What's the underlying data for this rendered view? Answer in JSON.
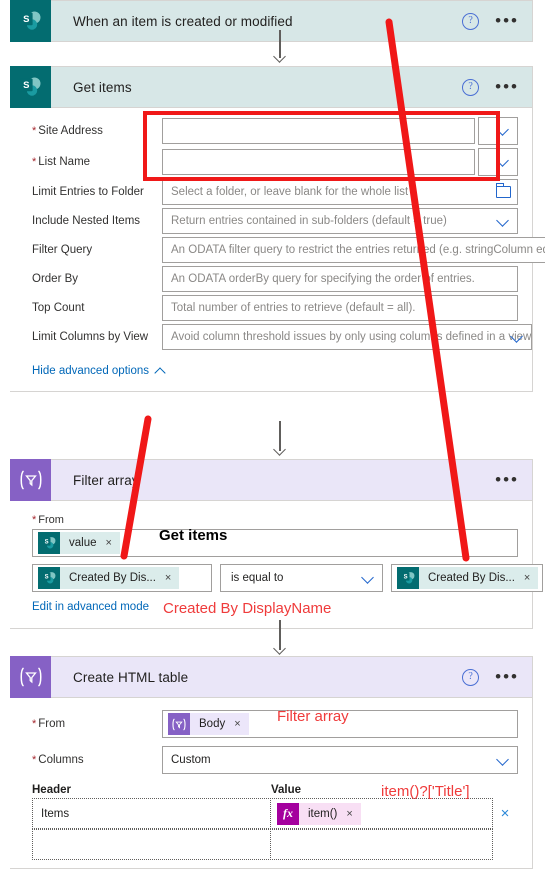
{
  "flow": {
    "steps": [
      {
        "id": "trigger",
        "title": "When an item is created or modified",
        "connector": "sharepoint",
        "icon": "sharepoint-icon",
        "help_icon": "help-icon",
        "more_icon": "more-options-icon"
      },
      {
        "id": "get-items",
        "title": "Get items",
        "connector": "sharepoint",
        "icon": "sharepoint-icon",
        "help_icon": "help-icon",
        "more_icon": "more-options-icon",
        "fields": [
          {
            "label": "Site Address",
            "required": true,
            "value": "",
            "placeholder": "",
            "control": "combo-split"
          },
          {
            "label": "List Name",
            "required": true,
            "value": "",
            "placeholder": "",
            "control": "combo-split"
          },
          {
            "label": "Limit Entries to Folder",
            "required": false,
            "value": "",
            "placeholder": "Select a folder, or leave blank for the whole list",
            "control": "folder-picker"
          },
          {
            "label": "Include Nested Items",
            "required": false,
            "value": "",
            "placeholder": "Return entries contained in sub-folders (default = true)",
            "control": "dropdown"
          },
          {
            "label": "Filter Query",
            "required": false,
            "value": "",
            "placeholder": "An ODATA filter query to restrict the entries returned (e.g. stringColumn eq 'stri",
            "control": "text"
          },
          {
            "label": "Order By",
            "required": false,
            "value": "",
            "placeholder": "An ODATA orderBy query for specifying the order of entries.",
            "control": "text"
          },
          {
            "label": "Top Count",
            "required": false,
            "value": "",
            "placeholder": "Total number of entries to retrieve (default = all).",
            "control": "text"
          },
          {
            "label": "Limit Columns by View",
            "required": false,
            "value": "",
            "placeholder": "Avoid column threshold issues by only using columns defined in a view",
            "control": "dropdown"
          }
        ],
        "advanced_link": "Hide advanced options"
      },
      {
        "id": "filter-array",
        "title": "Filter array",
        "connector": "flow",
        "icon": "filter-array-icon",
        "more_icon": "more-options-icon",
        "from_label": "From",
        "from_token": {
          "text": "value",
          "icon": "sharepoint-icon",
          "remove": "×"
        },
        "condition": {
          "left_token": {
            "text": "Created By Dis...",
            "icon": "sharepoint-icon",
            "remove": "×"
          },
          "operator": "is equal to",
          "right_token": {
            "text": "Created By Dis...",
            "icon": "sharepoint-icon",
            "remove": "×"
          }
        },
        "advanced_mode_link": "Edit in advanced mode"
      },
      {
        "id": "create-html-table",
        "title": "Create HTML table",
        "connector": "flow",
        "icon": "create-html-table-icon",
        "help_icon": "help-icon",
        "more_icon": "more-options-icon",
        "from_label": "From",
        "from_token": {
          "text": "Body",
          "icon": "filter-array-icon",
          "remove": "×"
        },
        "columns_label": "Columns",
        "columns_value": "Custom",
        "grid": {
          "headers": [
            "Header",
            "Value"
          ],
          "rows": [
            {
              "header": "Items",
              "value_token": {
                "text": "item()",
                "icon": "expression-icon",
                "remove": "×"
              },
              "delete": "×"
            },
            {
              "header": "",
              "value_token": null,
              "delete": ""
            }
          ]
        }
      }
    ]
  },
  "annotations": [
    {
      "id": "anno-get-items",
      "text": "Get items",
      "color": "#000000"
    },
    {
      "id": "anno-created-by-displayname",
      "text": "Created By DisplayName",
      "color": "#ef3b3b"
    },
    {
      "id": "anno-filter-array",
      "text": "Filter array",
      "color": "#ef3b3b"
    },
    {
      "id": "anno-item-title",
      "text": "item()?['Title']",
      "color": "#ef3b3b"
    }
  ],
  "colors": {
    "sharepoint_tile": "#036c70",
    "sharepoint_header": "#d7e7e7",
    "flow_tile": "#8661c5",
    "flow_header": "#eae6f8",
    "expression_tile": "#a4009e",
    "annotation_red": "#ef3b3b",
    "highlight_red": "#f01818",
    "link_blue": "#0067b8"
  }
}
